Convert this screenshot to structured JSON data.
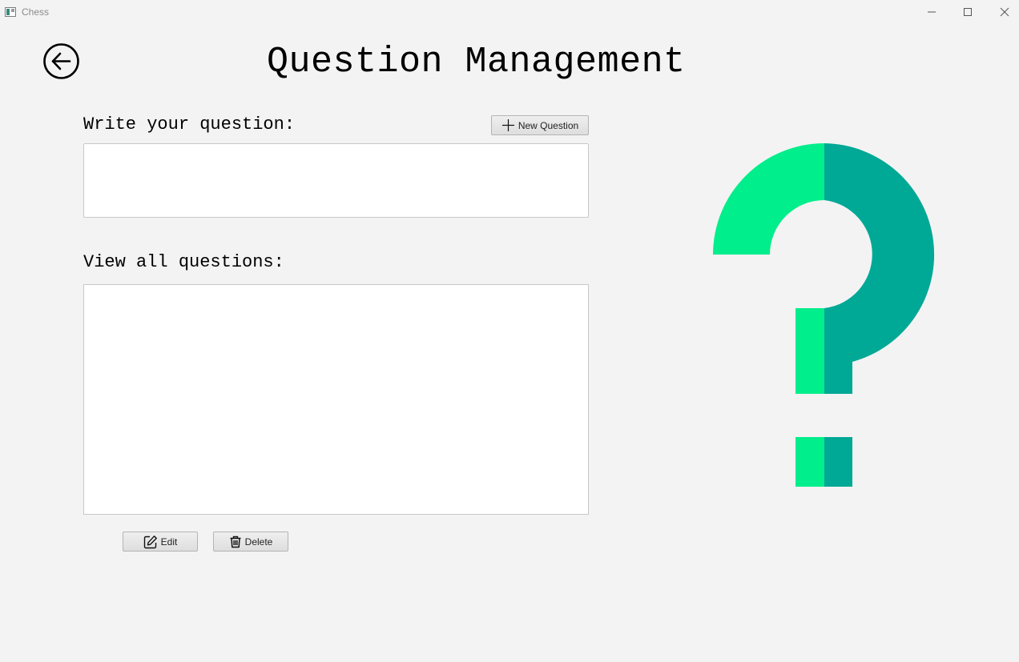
{
  "window": {
    "title": "Chess",
    "app_icon": "chessboard-icon",
    "controls": [
      "minimize-icon",
      "maximize-icon",
      "close-icon"
    ]
  },
  "back_button": {
    "icon": "arrow-left-circle-icon"
  },
  "page": {
    "title": "Question Management"
  },
  "question_form": {
    "label": "Write your question:",
    "new_button_label": "New Question",
    "new_button_icon": "plus-icon",
    "input_value": ""
  },
  "questions_view": {
    "label": "View all questions:",
    "items": []
  },
  "actions": {
    "edit_label": "Edit",
    "edit_icon": "edit-icon",
    "delete_label": "Delete",
    "delete_icon": "trash-icon"
  },
  "illustration": {
    "icon": "question-mark-icon",
    "colors": {
      "light": "#00ee8b",
      "dark": "#00a896"
    }
  },
  "colors": {
    "background": "#f3f3f3",
    "field": "#ffffff",
    "border": "#c8c8c8"
  }
}
